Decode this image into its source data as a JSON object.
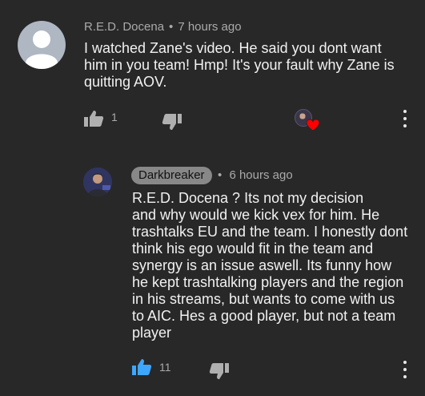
{
  "comment": {
    "author": "R.E.D. Docena",
    "separator": "•",
    "time": "7 hours ago",
    "lines": [
      "I watched Zane's video. He said you dont want",
      "him in you team! Hmp! It's your fault why Zane is",
      "quitting AOV."
    ],
    "like_count": "1"
  },
  "reply": {
    "author": "Darkbreaker",
    "separator": "•",
    "time": "6 hours ago",
    "lines": [
      "R.E.D. Docena ? Its not my decision",
      "and why would we kick vex for him. He",
      "trashtalks EU and the team. I honestly dont",
      "think his ego would fit in the team and",
      "synergy is an issue aswell. Its funny how",
      "he kept trashtalking players and the region",
      "in his streams, but wants to come with us",
      "to AIC. Hes a good player, but not a team",
      "player"
    ],
    "like_count": "11"
  },
  "colors": {
    "background": "#282828",
    "text": "#f1f1f1",
    "meta": "#aaaaaa",
    "liked_blue": "#3ea6ff",
    "heart_red": "#ff0000",
    "author_chip": "#888888"
  },
  "icons": {
    "like": "thumbs-up-icon",
    "dislike": "thumbs-down-icon",
    "heart": "heart-icon",
    "more": "more-vertical-icon"
  }
}
